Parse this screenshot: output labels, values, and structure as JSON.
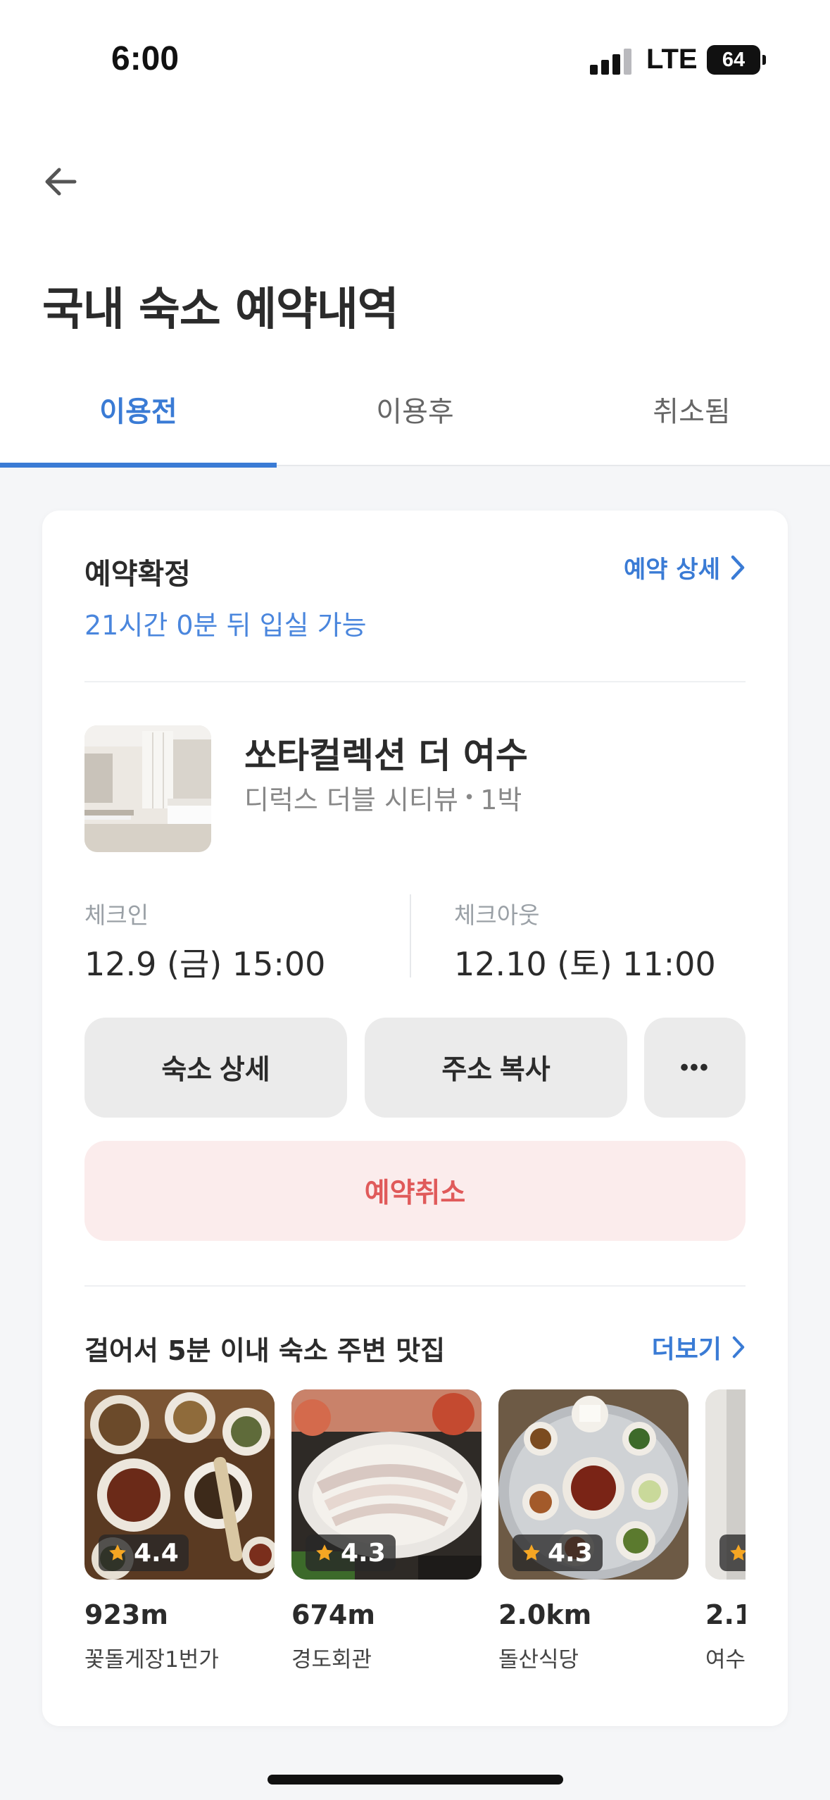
{
  "status_bar": {
    "time": "6:00",
    "network": "LTE",
    "battery": "64"
  },
  "header": {
    "title": "국내 숙소 예약내역"
  },
  "tabs": [
    {
      "label": "이용전",
      "active": true
    },
    {
      "label": "이용후",
      "active": false
    },
    {
      "label": "취소됨",
      "active": false
    }
  ],
  "reservation": {
    "status": "예약확정",
    "checkin_note": "21시간 0분 뒤 입실 가능",
    "detail_link": "예약 상세",
    "hotel_name": "쏘타컬렉션 더 여수",
    "room_type": "디럭스 더블 시티뷰",
    "separator": "•",
    "nights": "1박",
    "checkin_label": "체크인",
    "checkin_value": "12.9 (금) 15:00",
    "checkout_label": "체크아웃",
    "checkout_value": "12.10 (토) 11:00",
    "buttons": {
      "hotel_detail": "숙소 상세",
      "copy_address": "주소 복사",
      "more": "•••",
      "cancel": "예약취소"
    }
  },
  "nearby": {
    "title": "걸어서 5분 이내 숙소 주변 맛집",
    "more_link": "더보기",
    "restaurants": [
      {
        "rating": "4.4",
        "distance": "923m",
        "name": "꽃돌게장1번가"
      },
      {
        "rating": "4.3",
        "distance": "674m",
        "name": "경도회관"
      },
      {
        "rating": "4.3",
        "distance": "2.0km",
        "name": "돌산식당"
      },
      {
        "rating": "",
        "distance": "2.1",
        "name": "여수"
      }
    ]
  },
  "colors": {
    "accent": "#3a7bd5",
    "cancel_text": "#e05a5a",
    "cancel_bg": "#fbecec",
    "star": "#f5a623"
  }
}
